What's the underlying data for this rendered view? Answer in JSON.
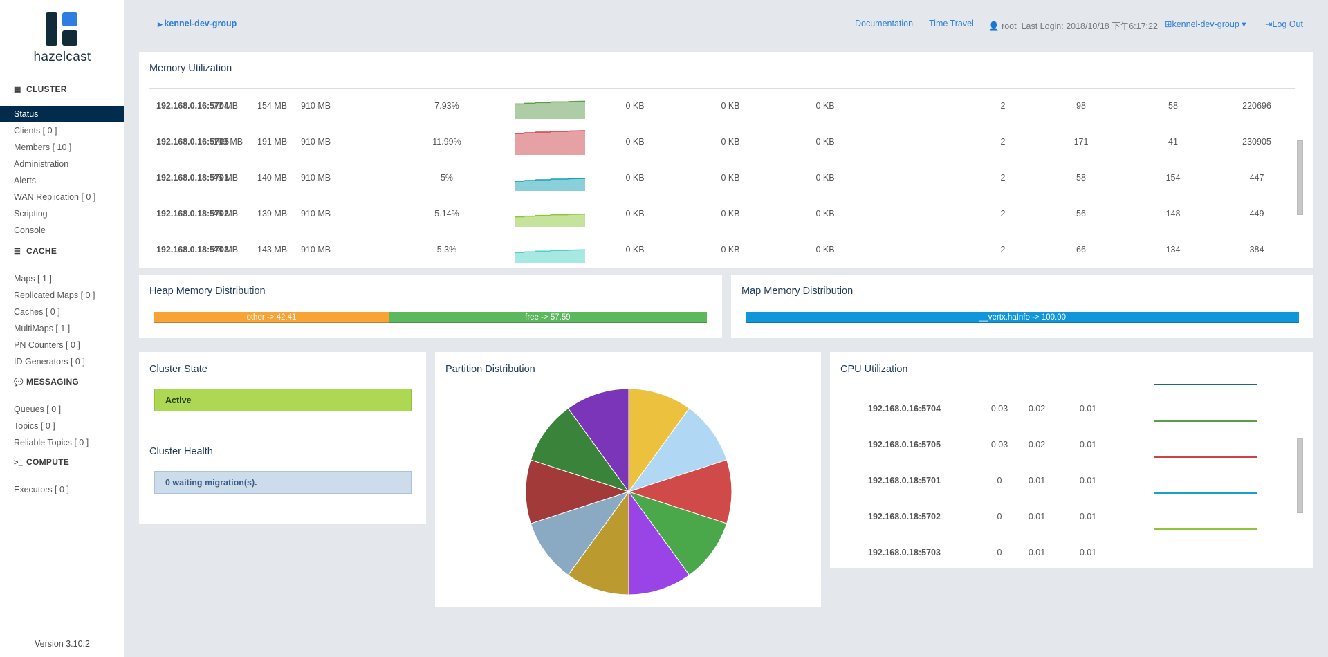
{
  "sidebar": {
    "logo_text": "hazelcast",
    "sections": [
      {
        "title": "CLUSTER",
        "icon": "grid-icon",
        "items": [
          "Status",
          "Clients [ 0 ]",
          "Members [ 10 ]",
          "Administration",
          "Alerts",
          "WAN Replication [ 0 ]",
          "Scripting",
          "Console"
        ]
      },
      {
        "title": "CACHE",
        "icon": "list-icon",
        "items": [
          "Maps [ 1 ]",
          "Replicated Maps [ 0 ]",
          "Caches [ 0 ]",
          "MultiMaps [ 1 ]",
          "PN Counters [ 0 ]",
          "ID Generators [ 0 ]"
        ]
      },
      {
        "title": "MESSAGING",
        "icon": "comments-icon",
        "items": [
          "Queues [ 0 ]",
          "Topics [ 0 ]",
          "Reliable Topics [ 0 ]"
        ]
      },
      {
        "title": "COMPUTE",
        "icon": "terminal-icon",
        "items": [
          "Executors [ 0 ]"
        ]
      }
    ],
    "active": "Status",
    "version": "Version 3.10.2"
  },
  "header": {
    "breadcrumb": "kennel-dev-group",
    "documentation": "Documentation",
    "time_travel": "Time Travel",
    "user": "root",
    "last_login": "Last Login: 2018/10/18 下午6:17:22",
    "group": "kennel-dev-group",
    "logout": "Log Out"
  },
  "memory": {
    "title": "Memory Utilization",
    "rows": [
      {
        "member": "192.168.0.16:5704",
        "used": "72 MB",
        "free": "154 MB",
        "max": "910 MB",
        "pct": "7.93%",
        "usage": 7.93,
        "c1": "0 KB",
        "c2": "0 KB",
        "c3": "0 KB",
        "n1": "2",
        "n2": "98",
        "n3": "58",
        "n4": "220696",
        "line": "#5a9e4b",
        "fill": "#aecda6"
      },
      {
        "member": "192.168.0.16:5705",
        "used": "109 MB",
        "free": "191 MB",
        "max": "910 MB",
        "pct": "11.99%",
        "usage": 11.99,
        "c1": "0 KB",
        "c2": "0 KB",
        "c3": "0 KB",
        "n1": "2",
        "n2": "171",
        "n3": "41",
        "n4": "230905",
        "line": "#d0404a",
        "fill": "#e6a1a5"
      },
      {
        "member": "192.168.0.18:5701",
        "used": "45 MB",
        "free": "140 MB",
        "max": "910 MB",
        "pct": "5%",
        "usage": 5,
        "c1": "0 KB",
        "c2": "0 KB",
        "c3": "0 KB",
        "n1": "2",
        "n2": "58",
        "n3": "154",
        "n4": "447",
        "line": "#1a9fb5",
        "fill": "#8ad0da"
      },
      {
        "member": "192.168.0.18:5702",
        "used": "46 MB",
        "free": "139 MB",
        "max": "910 MB",
        "pct": "5.14%",
        "usage": 5.14,
        "c1": "0 KB",
        "c2": "0 KB",
        "c3": "0 KB",
        "n1": "2",
        "n2": "56",
        "n3": "148",
        "n4": "449",
        "line": "#8cc43a",
        "fill": "#c5e39a"
      },
      {
        "member": "192.168.0.18:5703",
        "used": "48 MB",
        "free": "143 MB",
        "max": "910 MB",
        "pct": "5.3%",
        "usage": 5.3,
        "c1": "0 KB",
        "c2": "0 KB",
        "c3": "0 KB",
        "n1": "2",
        "n2": "66",
        "n3": "134",
        "n4": "384",
        "line": "#4fd1c5",
        "fill": "#a8e8e2"
      }
    ]
  },
  "heap": {
    "title": "Heap Memory Distribution",
    "segments": [
      {
        "label": "other -> 42.41",
        "value": 42.41,
        "color": "#f7a335"
      },
      {
        "label": "free -> 57.59",
        "value": 57.59,
        "color": "#5cb85c"
      }
    ]
  },
  "map_memory": {
    "title": "Map Memory Distribution",
    "segments": [
      {
        "label": "__vertx.haInfo -> 100.00",
        "value": 100,
        "color": "#1296db"
      }
    ]
  },
  "cluster_state": {
    "title": "Cluster State",
    "value": "Active"
  },
  "cluster_health": {
    "title": "Cluster Health",
    "value": "0 waiting migration(s)."
  },
  "partition": {
    "title": "Partition Distribution",
    "colors": [
      "#ecc13d",
      "#b0d8f5",
      "#d04a4a",
      "#4aa84a",
      "#9a44e8",
      "#bb9b30",
      "#8aaac4",
      "#a33a3a",
      "#3a833a",
      "#7a35b8"
    ]
  },
  "cpu": {
    "title": "CPU Utilization",
    "rows": [
      {
        "member": "192.168.0.16:5704",
        "a": "0.03",
        "b": "0.02",
        "c": "0.01",
        "line": "#5a9e4b"
      },
      {
        "member": "192.168.0.16:5705",
        "a": "0.03",
        "b": "0.02",
        "c": "0.01",
        "line": "#d0404a"
      },
      {
        "member": "192.168.0.18:5701",
        "a": "0",
        "b": "0.01",
        "c": "0.01",
        "line": "#1aa0c8"
      },
      {
        "member": "192.168.0.18:5702",
        "a": "0",
        "b": "0.01",
        "c": "0.01",
        "line": "#8cc43a"
      },
      {
        "member": "192.168.0.18:5703",
        "a": "0",
        "b": "0.01",
        "c": "0.01",
        "line": ""
      }
    ]
  }
}
